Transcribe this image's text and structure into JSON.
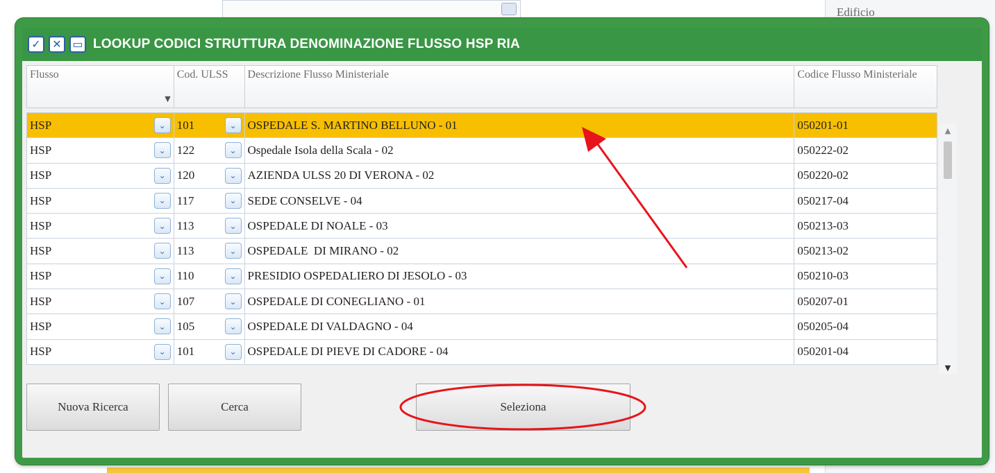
{
  "background": {
    "edificio_label": "Edificio"
  },
  "dialog": {
    "title": "LOOKUP CODICI STRUTTURA DENOMINAZIONE FLUSSO HSP RIA",
    "title_icons": [
      "check-icon",
      "close-icon",
      "window-icon"
    ],
    "columns": [
      "Flusso",
      "Cod. ULSS",
      "Descrizione Flusso Ministeriale",
      "Codice Flusso Ministeriale"
    ],
    "rows": [
      {
        "flusso": "HSP",
        "ulss": "101",
        "descrizione": "OSPEDALE S. MARTINO BELLUNO - 01",
        "codice": "050201-01",
        "selected": true
      },
      {
        "flusso": "HSP",
        "ulss": "122",
        "descrizione": "Ospedale Isola della Scala - 02",
        "codice": "050222-02",
        "selected": false
      },
      {
        "flusso": "HSP",
        "ulss": "120",
        "descrizione": "AZIENDA ULSS 20 DI VERONA - 02",
        "codice": "050220-02",
        "selected": false
      },
      {
        "flusso": "HSP",
        "ulss": "117",
        "descrizione": "SEDE CONSELVE - 04",
        "codice": "050217-04",
        "selected": false
      },
      {
        "flusso": "HSP",
        "ulss": "113",
        "descrizione": "OSPEDALE DI NOALE - 03",
        "codice": "050213-03",
        "selected": false
      },
      {
        "flusso": "HSP",
        "ulss": "113",
        "descrizione": "OSPEDALE  DI MIRANO - 02",
        "codice": "050213-02",
        "selected": false
      },
      {
        "flusso": "HSP",
        "ulss": "110",
        "descrizione": "PRESIDIO OSPEDALIERO DI JESOLO - 03",
        "codice": "050210-03",
        "selected": false
      },
      {
        "flusso": "HSP",
        "ulss": "107",
        "descrizione": "OSPEDALE DI CONEGLIANO - 01",
        "codice": "050207-01",
        "selected": false
      },
      {
        "flusso": "HSP",
        "ulss": "105",
        "descrizione": "OSPEDALE DI VALDAGNO - 04",
        "codice": "050205-04",
        "selected": false
      },
      {
        "flusso": "HSP",
        "ulss": "101",
        "descrizione": "OSPEDALE DI PIEVE DI CADORE - 04",
        "codice": "050201-04",
        "selected": false
      }
    ],
    "buttons": {
      "nuova_ricerca": "Nuova Ricerca",
      "cerca": "Cerca",
      "seleziona": "Seleziona"
    }
  },
  "colors": {
    "titlebar": "#399644",
    "selected_row": "#f7bf00",
    "annotation": "#e8141b"
  }
}
